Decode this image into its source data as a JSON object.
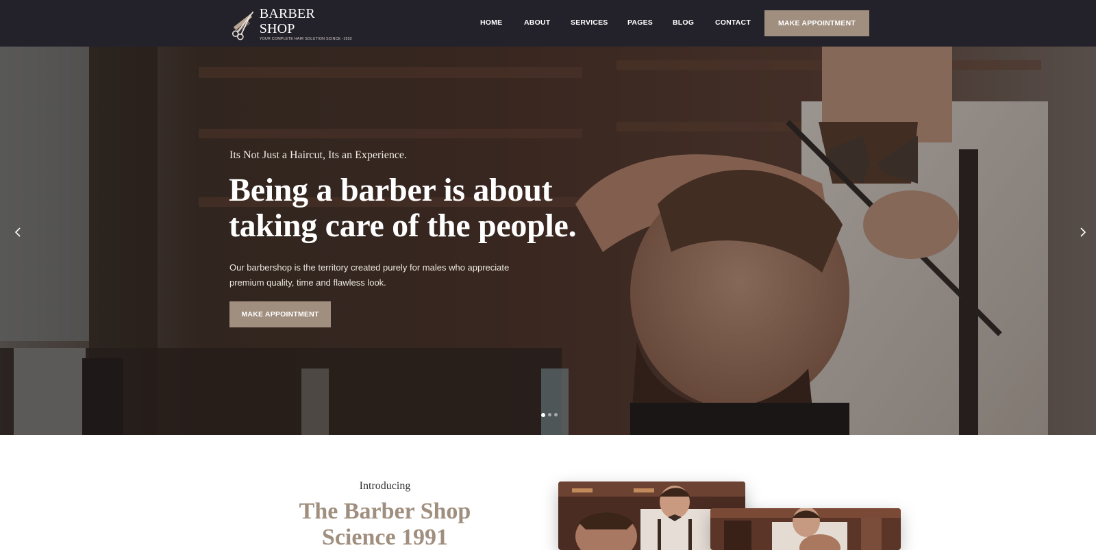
{
  "brand": {
    "name": "BARBER SHOP",
    "tagline": "YOUR COMPLETE HAIR SOLUTION SCINCE -1952"
  },
  "nav": {
    "items": [
      {
        "label": "HOME"
      },
      {
        "label": "ABOUT"
      },
      {
        "label": "SERVICES"
      },
      {
        "label": "PAGES"
      },
      {
        "label": "BLOG"
      },
      {
        "label": "CONTACT"
      }
    ],
    "cta": "MAKE APPOINTMENT"
  },
  "hero": {
    "kicker": "Its Not Just a Haircut, Its an Experience.",
    "title_line1": "Being a barber is about",
    "title_line2": "taking care of the people.",
    "desc_line1": "Our barbershop is the territory created purely for males who appreciate",
    "desc_line2": "premium quality, time and flawless look.",
    "cta": "MAKE APPOINTMENT",
    "slides_count": 3,
    "active_slide": 1
  },
  "intro": {
    "kicker": "Introducing",
    "title_line1": "The Barber Shop",
    "title_line2": "Science 1991"
  },
  "colors": {
    "header_bg": "#23222a",
    "accent": "#a08f7f",
    "text_white": "#ffffff"
  }
}
